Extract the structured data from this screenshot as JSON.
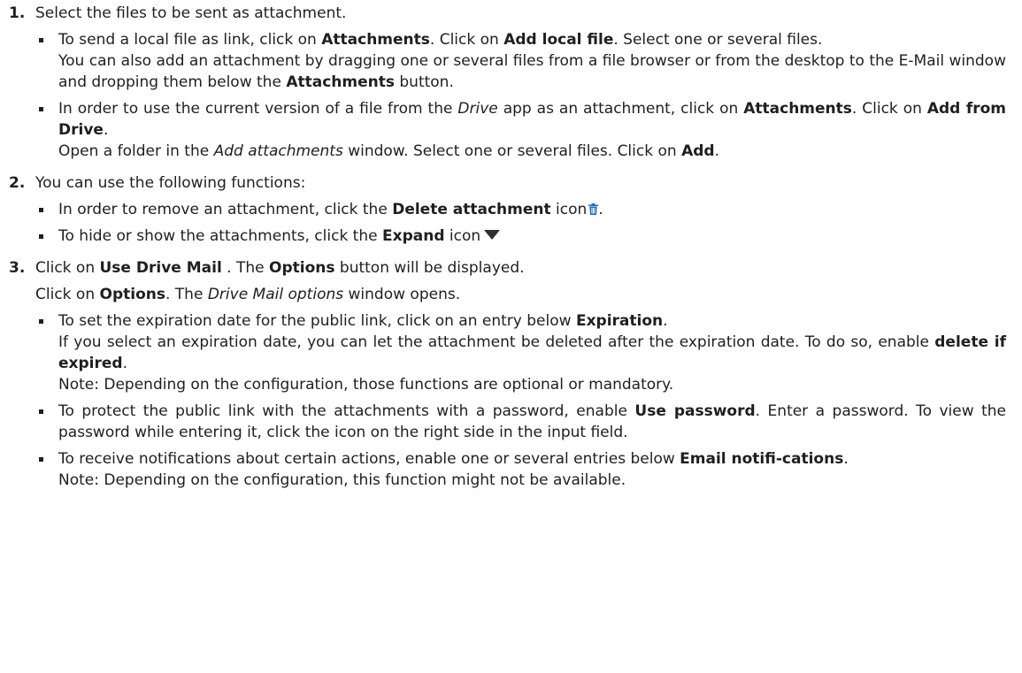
{
  "colors": {
    "text": "#1f1f1f",
    "icon_blue": "#1b6ec2"
  },
  "steps": [
    {
      "num": "1.",
      "intro": "Select the files to be sent as attachment.",
      "bullets": [
        {
          "t1": "To send a local file as link, click on ",
          "b1": "Attachments",
          "t2": ". Click on ",
          "b2": "Add local file",
          "t3": ". Select one or several files.",
          "t4": "You can also add an attachment by dragging one or several files from a file browser or from the desktop to the E-Mail window and dropping them below the ",
          "b3": "Attachments",
          "t5": " button."
        },
        {
          "t1": "In order to use the current version of a file from the ",
          "i1": "Drive",
          "t2": " app as an attachment, click on ",
          "b1": "Attachments",
          "t3": ". Click on ",
          "b2": "Add from Drive",
          "t4": ".",
          "t5": "Open a folder in the ",
          "i2": "Add attachments",
          "t6": " window. Select one or several files. Click on ",
          "b3": "Add",
          "t7": "."
        }
      ]
    },
    {
      "num": "2.",
      "intro": "You can use the following functions:",
      "bullets": [
        {
          "t1": "In order to remove an attachment, click the ",
          "b1": "Delete attachment",
          "t2": " icon",
          "icon": "trash-icon",
          "t3": "."
        },
        {
          "t1": "To hide or show the attachments, click the ",
          "b1": "Expand",
          "t2": " icon",
          "icon": "triangle-down-icon"
        }
      ]
    },
    {
      "num": "3.",
      "intro_t1": "Click on ",
      "intro_b1": "Use Drive Mail",
      "intro_t2": " . The ",
      "intro_b2": "Options",
      "intro_t3": " button will be displayed.",
      "line2_t1": "Click on ",
      "line2_b1": "Options",
      "line2_t2": ". The ",
      "line2_i1": "Drive Mail options",
      "line2_t3": " window opens.",
      "bullets": [
        {
          "t1": "To set the expiration date for the public link, click on an entry below ",
          "b1": "Expiration",
          "t2": ".",
          "t3": "If you select an expiration date, you can let the attachment be deleted after the expiration date. To do so, enable ",
          "b2": "delete if expired",
          "t4": ".",
          "t5": "Note: Depending on the configuration, those functions are optional or mandatory."
        },
        {
          "t1": "To protect the public link with the attachments with a password, enable ",
          "b1": "Use password",
          "t2": ". Enter a password. To view the password while entering it, click the icon on the right side in the input field."
        },
        {
          "t1": "To receive notifications about certain actions, enable one or several entries below ",
          "b1": "Email notifi-cations",
          "t2": ".",
          "t3": "Note: Depending on the configuration, this function might not be available."
        }
      ]
    }
  ]
}
